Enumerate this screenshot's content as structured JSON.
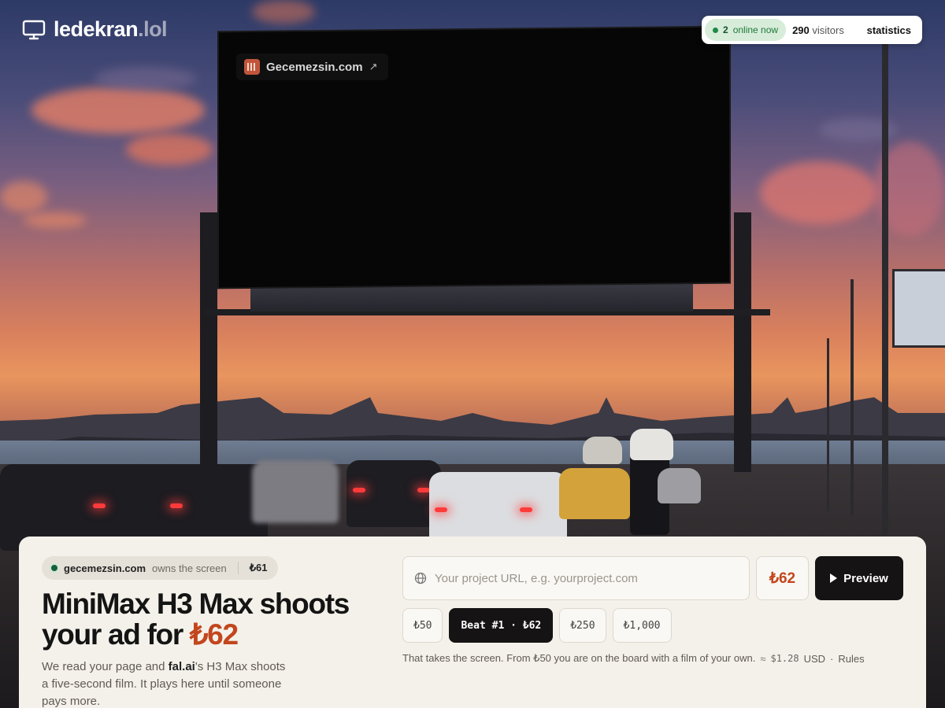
{
  "header": {
    "brand_name": "ledekran",
    "brand_tld": ".lol",
    "online_count": "2",
    "online_label": "online now",
    "visitors_count": "290",
    "visitors_label": "visitors",
    "statistics_label": "statistics"
  },
  "billboard": {
    "sponsor_name": "Gecemezsin.com"
  },
  "owner": {
    "domain": "gecemezsin.com",
    "label": "owns the screen",
    "price": "₺61"
  },
  "headline": {
    "line1": "MiniMax H3 Max shoots",
    "line2_prefix": "your ad for ",
    "price": "₺62"
  },
  "description": {
    "part1": "We read your page and ",
    "brand": "fal.ai",
    "part2": "'s H3 Max shoots a five-second film. It plays here until someone pays more."
  },
  "form": {
    "url_placeholder": "Your project URL, e.g. yourproject.com",
    "price": "₺62",
    "preview_label": "Preview",
    "amounts": [
      "₺50",
      "Beat #1 · ₺62",
      "₺250",
      "₺1,000"
    ],
    "selected_amount_index": 1
  },
  "note": {
    "text": "That takes the screen. From ₺50 you are on the board with a film of your own.",
    "approx": "≈",
    "usd": "$1.28",
    "usd_unit": "USD",
    "sep": "·",
    "rules": "Rules"
  },
  "colors": {
    "accent": "#c2461e",
    "online_green": "#1e8a45",
    "dark": "#151313",
    "panel_bg": "#f4f1ea"
  },
  "icons": [
    "monitor-icon",
    "external-link-icon",
    "globe-icon",
    "play-icon",
    "favicon-icon"
  ]
}
